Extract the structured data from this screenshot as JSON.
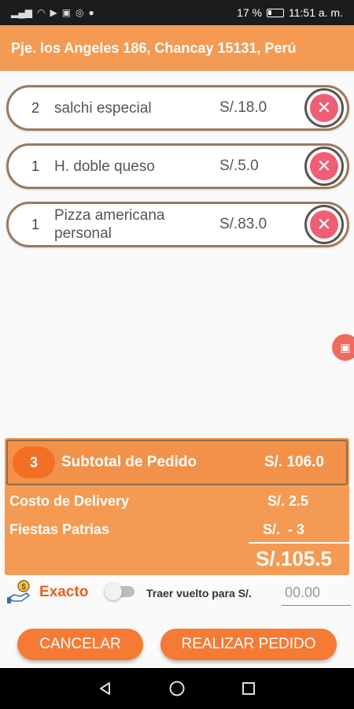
{
  "status_bar": {
    "battery": "17 %",
    "time": "11:51 a. m."
  },
  "header": {
    "address": "Pje. los Angeles 186, Chancay 15131, Perú"
  },
  "order_items": [
    {
      "qty": "2",
      "name": "salchi especial",
      "price": "S/.18.0"
    },
    {
      "qty": "1",
      "name": "H. doble queso",
      "price": "S/.5.0"
    },
    {
      "qty": "1",
      "name": "Pizza americana personal",
      "price": "S/.83.0"
    }
  ],
  "summary": {
    "item_count": "3",
    "subtotal_label": "Subtotal de  Pedido",
    "subtotal_value": "S/. 106.0",
    "delivery_label": "Costo de Delivery",
    "delivery_value": "S/. 2.5",
    "discount_label": "Fiestas Patrias",
    "discount_value": "S/.  - 3",
    "total": "S/.105.5"
  },
  "payment": {
    "exact_label": "Exacto",
    "change_label": "Traer vuelto para S/.",
    "change_placeholder": "00.00"
  },
  "buttons": {
    "cancel": "CANCELAR",
    "submit": "REALIZAR PEDIDO"
  },
  "colors": {
    "primary": "#f49a52",
    "accent": "#f57a34",
    "remove": "#ef5f74"
  }
}
